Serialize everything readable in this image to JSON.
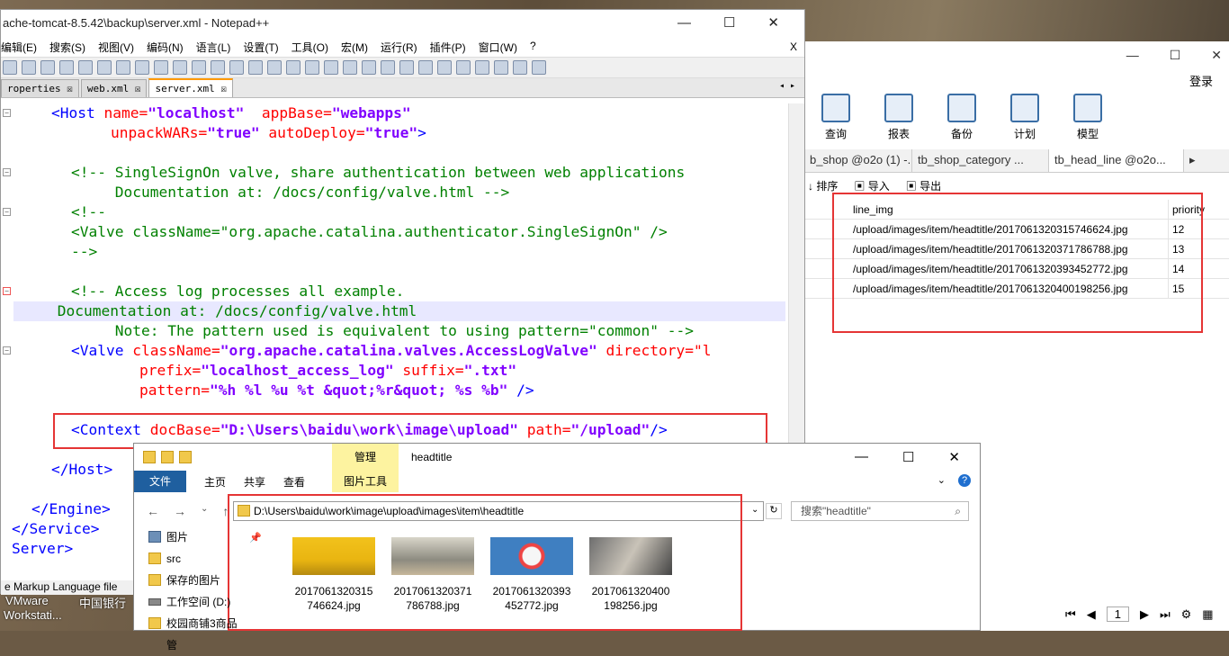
{
  "notepad": {
    "title": "ache-tomcat-8.5.42\\backup\\server.xml - Notepad++",
    "close_x": "X",
    "menu": [
      "编辑(E)",
      "搜索(S)",
      "视图(V)",
      "编码(N)",
      "语言(L)",
      "设置(T)",
      "工具(O)",
      "宏(M)",
      "运行(R)",
      "插件(P)",
      "窗口(W)",
      "?"
    ],
    "tabs": [
      "roperties",
      "web.xml",
      "server.xml"
    ],
    "active_tab": "server.xml",
    "status": "e Markup Language file",
    "code": {
      "l1_tag": "<Host ",
      "l1_a1": "name=",
      "l1_v1": "\"localhost\"",
      "l1_a2": "  appBase=",
      "l1_v2": "\"webapps\"",
      "l2_a1": "unpackWARs=",
      "l2_v1": "\"true\"",
      "l2_a2": " autoDeploy=",
      "l2_v2": "\"true\"",
      "l2_end": ">",
      "l4": "<!-- SingleSignOn valve, share authentication between web applications",
      "l5": "     Documentation at: /docs/config/valve.html -->",
      "l6": "<!--",
      "l7": "<Valve className=\"org.apache.catalina.authenticator.SingleSignOn\" />",
      "l8": "-->",
      "l10": "<!-- Access log processes all example.",
      "l11": "     Documentation at: /docs/config/valve.html",
      "l12": "     Note: The pattern used is equivalent to using pattern=\"common\" -->",
      "l13_tag": "<Valve ",
      "l13_a1": "className=",
      "l13_v1": "\"org.apache.catalina.valves.AccessLogValve\"",
      "l13_a2": " directory=\"l",
      "l14_a1": "prefix=",
      "l14_v1": "\"localhost_access_log\"",
      "l14_a2": " suffix=",
      "l14_v2": "\".txt\"",
      "l15_a1": "pattern=",
      "l15_v1": "\"%h %l %u %t &quot;%r&quot; %s %b\"",
      "l15_end": " />",
      "l17_tag": "<Context ",
      "l17_a1": "docBase=",
      "l17_v1": "\"D:\\Users\\baidu\\work\\image\\upload\"",
      "l17_a2": " path=",
      "l17_v2": "\"/upload\"",
      "l17_end": "/>",
      "l19": "</Host>",
      "l21": "</Engine>",
      "l22": "</Service>",
      "l23": "Server>"
    }
  },
  "navicat": {
    "login": "登录",
    "tools": [
      "查询",
      "报表",
      "备份",
      "计划",
      "模型"
    ],
    "tabs": [
      "b_shop @o2o (1) -...",
      "tb_shop_category ...",
      "tb_head_line @o2o..."
    ],
    "sub": [
      "排序",
      "导入",
      "导出"
    ],
    "columns": [
      "line_img",
      "priority"
    ],
    "rows": [
      {
        "img": "/upload/images/item/headtitle/2017061320315746624.jpg",
        "p": "12"
      },
      {
        "img": "/upload/images/item/headtitle/2017061320371786788.jpg",
        "p": "13"
      },
      {
        "img": "/upload/images/item/headtitle/2017061320393452772.jpg",
        "p": "14"
      },
      {
        "img": "/upload/images/item/headtitle/2017061320400198256.jpg",
        "p": "15"
      }
    ],
    "page": "1"
  },
  "explorer": {
    "manage": "管理",
    "title": "headtitle",
    "ribbon": [
      "文件",
      "主页",
      "共享",
      "查看"
    ],
    "pictool": "图片工具",
    "path": "D:\\Users\\baidu\\work\\image\\upload\\images\\item\\headtitle",
    "search_placeholder": "搜索\"headtitle\"",
    "sidebar": [
      "图片",
      "src",
      "保存的图片",
      "工作空间 (D:)",
      "校园商铺3商品管"
    ],
    "files": [
      {
        "l1": "2017061320315",
        "l2": "746624.jpg"
      },
      {
        "l1": "2017061320371",
        "l2": "786788.jpg"
      },
      {
        "l1": "2017061320393",
        "l2": "452772.jpg"
      },
      {
        "l1": "2017061320400",
        "l2": "198256.jpg"
      }
    ]
  },
  "desktop": {
    "icon1_l1": "VMware",
    "icon1_l2": "Workstati...",
    "icon2": "中国银行"
  }
}
